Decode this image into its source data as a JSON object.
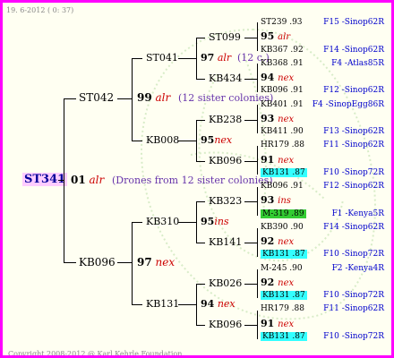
{
  "header": {
    "date": "19. 6-2012 ( 0: 37)"
  },
  "footer": {
    "copyright": "Copyright 2008-2012 @ Karl Kehrle Foundation."
  },
  "root": {
    "name": "ST341",
    "gen": "01",
    "race": "alr",
    "note": "(Drones from 12 sister colonies)"
  },
  "gen2": {
    "upper": {
      "name": "ST042"
    },
    "lower": {
      "name": "KB096"
    }
  },
  "gen3": {
    "a": {
      "num": "99",
      "race": "alr",
      "note": "(12 sister colonies)"
    },
    "b": {
      "num": "97",
      "race": "nex"
    }
  },
  "gen4": {
    "st041": "ST041",
    "kb008": "KB008",
    "kb310": "KB310",
    "kb131": "KB131"
  },
  "gen5": {
    "a": {
      "num": "97",
      "race": "alr",
      "note": "(12 c.)"
    },
    "b": {
      "num": "95",
      "race": "nex"
    },
    "c": {
      "num": "95",
      "race": "ins"
    },
    "d": {
      "num": "94",
      "race": "nex"
    }
  },
  "gen6": {
    "st099": "ST099",
    "kb434": "KB434",
    "kb238": "KB238",
    "kb096a": "KB096",
    "kb323": "KB323",
    "kb141": "KB141",
    "kb026": "KB026",
    "kb096b": "KB096"
  },
  "right": [
    {
      "t": "ST239 .93",
      "i": "F15 -Sinop62R"
    },
    {
      "t": "95 alr",
      "i": ""
    },
    {
      "t": "KB367 .92",
      "i": "F14 -Sinop62R"
    },
    {
      "t": "KB368 .91",
      "i": "F4 -Atlas85R"
    },
    {
      "t": "94 nex",
      "i": ""
    },
    {
      "t": "KB096 .91",
      "i": "F12 -Sinop62R"
    },
    {
      "t": "KB401 .91",
      "i": "F4 -SinopEgg86R"
    },
    {
      "t": "93 nex",
      "i": ""
    },
    {
      "t": "KB411 .90",
      "i": "F13 -Sinop62R"
    },
    {
      "t": "HR179 .88",
      "i": "F11 -Sinop62R"
    },
    {
      "t": "91 nex",
      "i": ""
    },
    {
      "t": "KB131 .87",
      "i": "F10 -Sinop72R"
    },
    {
      "t": "KB096 .91",
      "i": "F12 -Sinop62R"
    },
    {
      "t": "93 ins",
      "i": ""
    },
    {
      "t": "M-319 .89",
      "i": "F1 -Kenya5R"
    },
    {
      "t": "KB390 .90",
      "i": "F14 -Sinop62R"
    },
    {
      "t": "92 nex",
      "i": ""
    },
    {
      "t": "KB131 .87",
      "i": "F10 -Sinop72R"
    },
    {
      "t": "M-245 .90",
      "i": "F2 -Kenya4R"
    },
    {
      "t": "92 nex",
      "i": ""
    },
    {
      "t": "KB131 .87",
      "i": "F10 -Sinop72R"
    },
    {
      "t": "HR179 .88",
      "i": "F11 -Sinop62R"
    },
    {
      "t": "91 nex",
      "i": ""
    },
    {
      "t": "KB131 .87",
      "i": "F10 -Sinop72R"
    }
  ]
}
